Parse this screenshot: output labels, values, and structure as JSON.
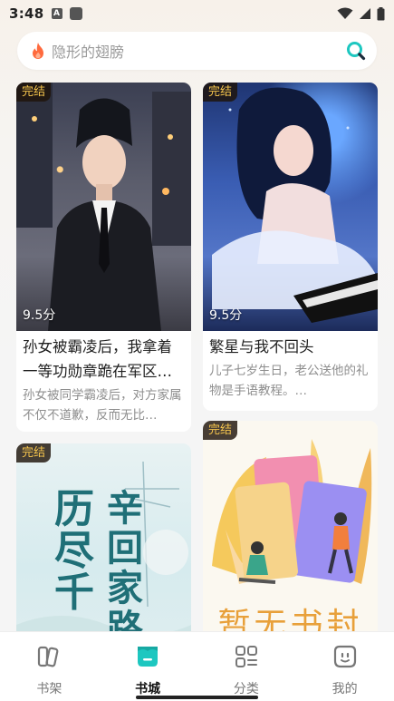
{
  "status": {
    "time": "3:48",
    "a_icon": "A"
  },
  "search": {
    "placeholder": "隐形的翅膀",
    "icon_left": "flame-icon",
    "icon_right": "search-icon"
  },
  "books": [
    {
      "tag": "完结",
      "score": "9.5分",
      "title": "孙女被霸凌后，我拿着一等功勋章跪在军区门…",
      "desc": "孙女被同学霸凌后，对方家属不仅不道歉，反而无比…"
    },
    {
      "tag": "完结",
      "score": "9.5分",
      "title": "繁星与我不回头",
      "desc": "儿子七岁生日，老公送他的礼物是手语教程。…"
    },
    {
      "tag": "完结",
      "cover_text": [
        "历",
        "尽",
        "千",
        "辛",
        "回",
        "家",
        "路"
      ]
    },
    {
      "tag": "完结",
      "cover_text": "暂无书封"
    }
  ],
  "tabs": [
    {
      "label": "书架",
      "icon": "bookshelf-icon",
      "active": false
    },
    {
      "label": "书城",
      "icon": "bookstore-icon",
      "active": true
    },
    {
      "label": "分类",
      "icon": "category-icon",
      "active": false
    },
    {
      "label": "我的",
      "icon": "profile-icon",
      "active": false
    }
  ],
  "colors": {
    "accent": "#1dc7c0",
    "tag_text": "#f7c64d"
  }
}
